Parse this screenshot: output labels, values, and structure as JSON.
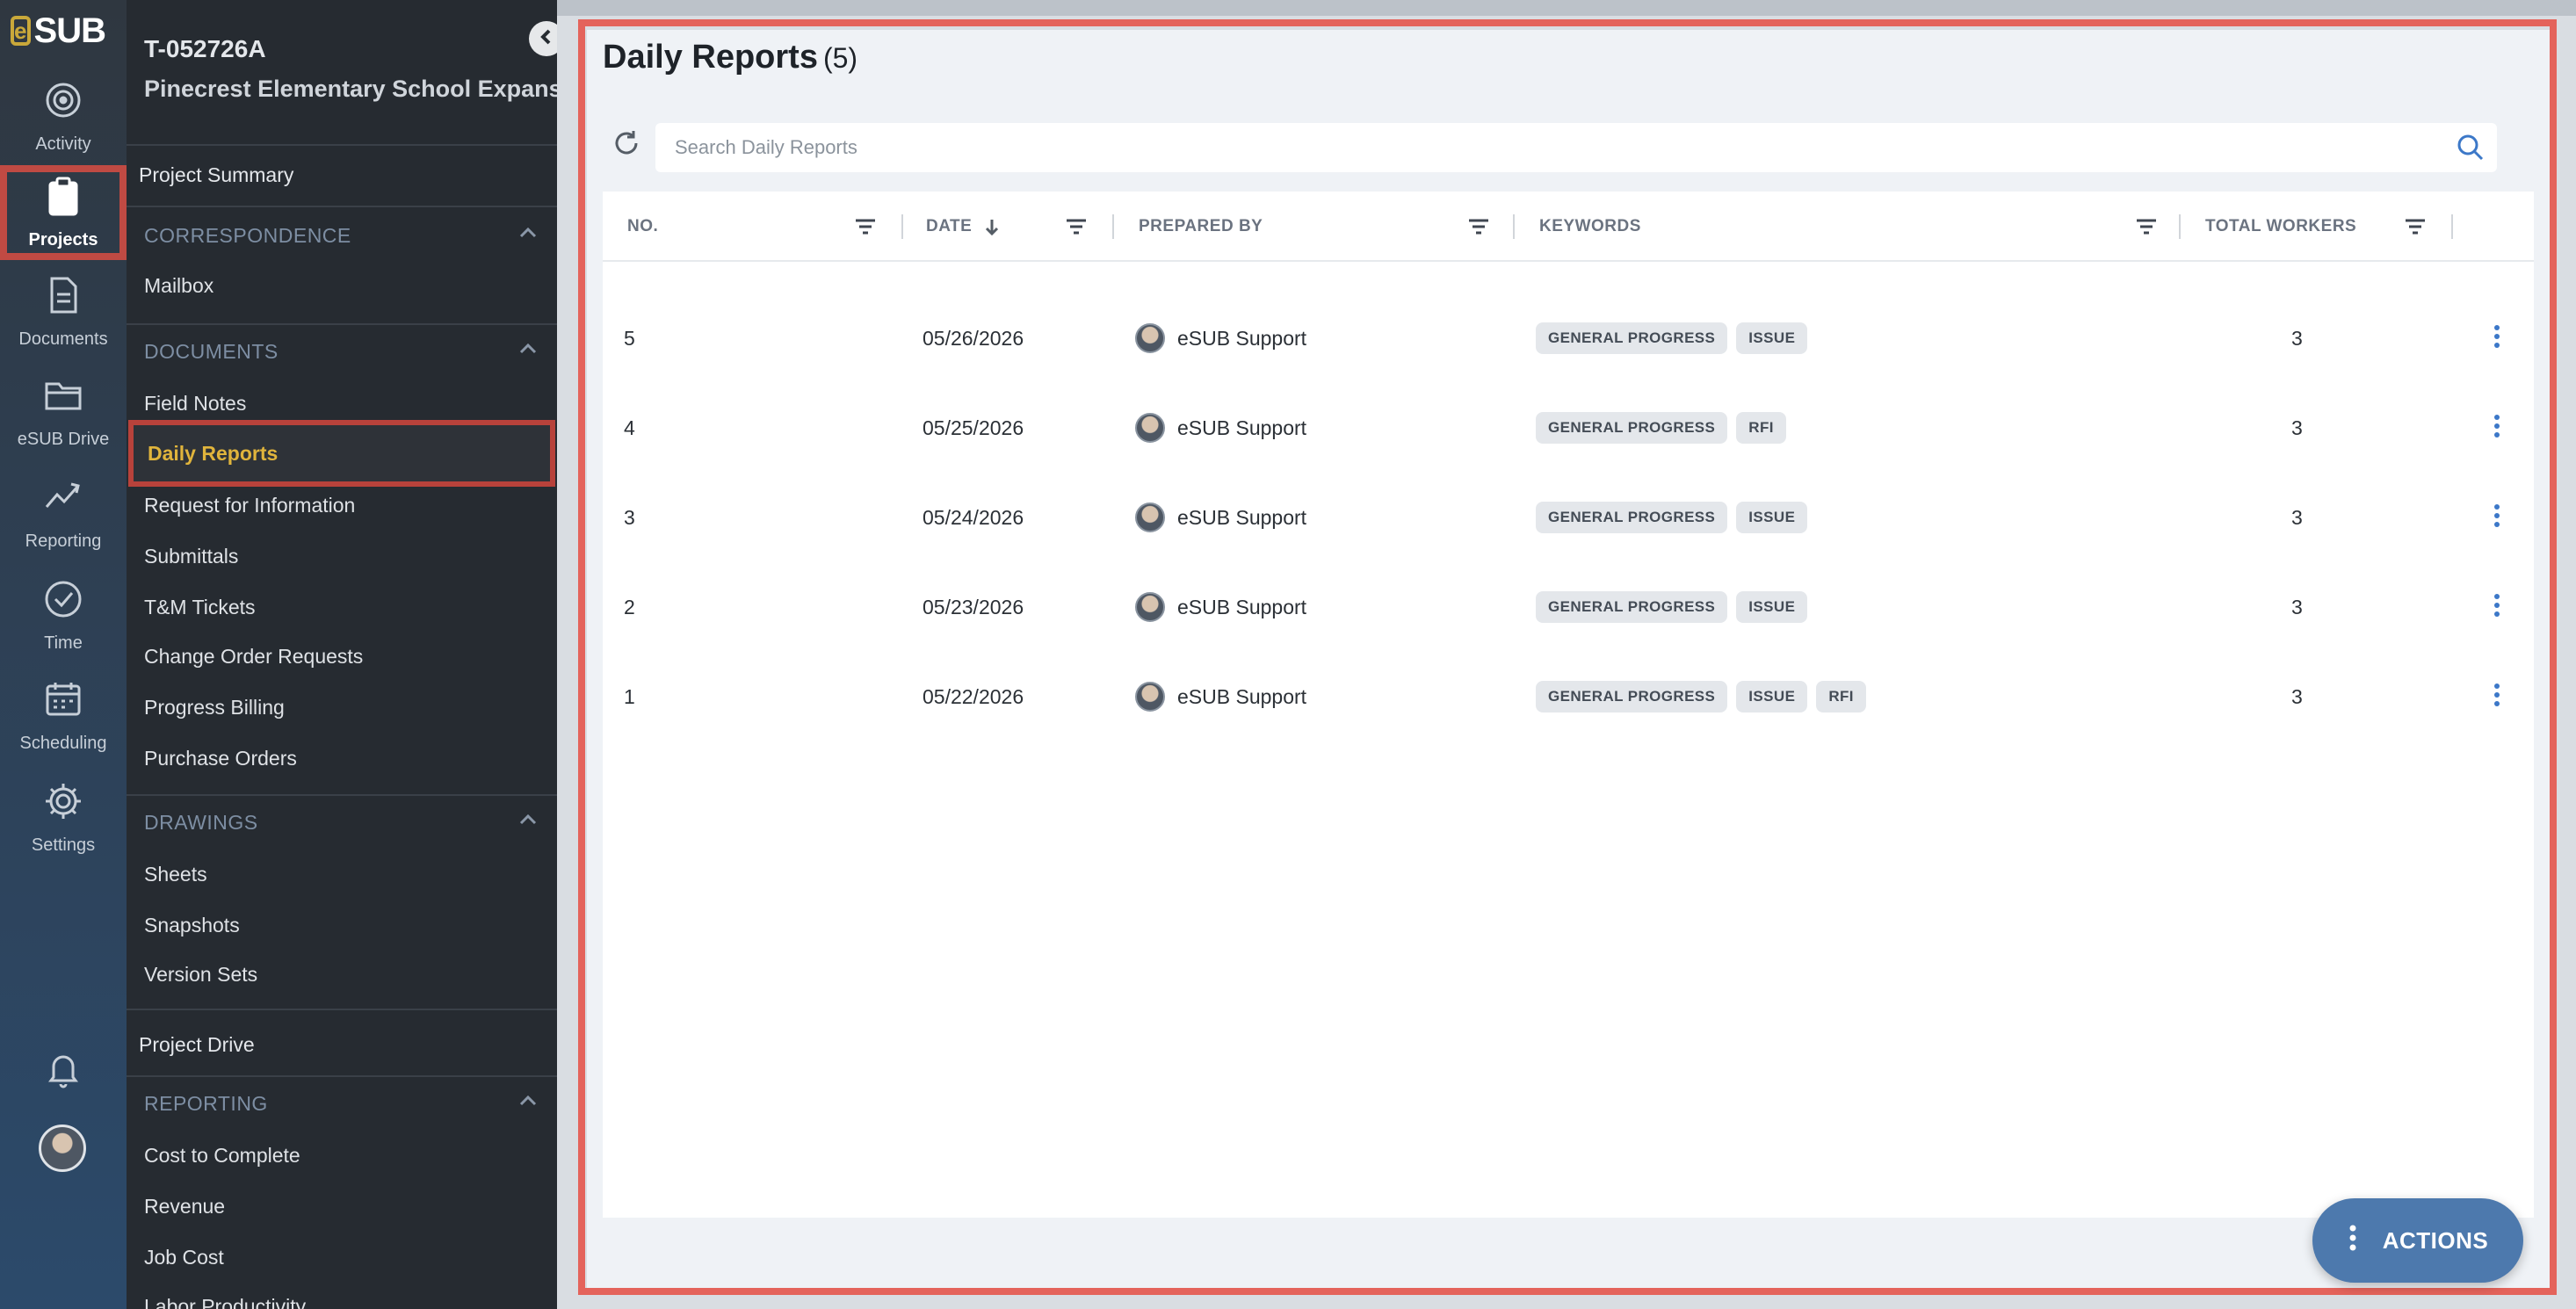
{
  "rail": {
    "logo_text": "SUB",
    "logo_mark": "e",
    "items": [
      {
        "label": "Activity",
        "icon": "activity-icon"
      },
      {
        "label": "Projects",
        "icon": "clipboard-icon"
      },
      {
        "label": "Documents",
        "icon": "document-icon"
      },
      {
        "label": "eSUB Drive",
        "icon": "folder-icon"
      },
      {
        "label": "Reporting",
        "icon": "chart-line-icon"
      },
      {
        "label": "Time",
        "icon": "clock-check-icon"
      },
      {
        "label": "Scheduling",
        "icon": "calendar-icon"
      },
      {
        "label": "Settings",
        "icon": "gear-icon"
      }
    ]
  },
  "project": {
    "code": "T-052726A",
    "name": "Pinecrest Elementary School Expansion"
  },
  "nav": {
    "project_summary": "Project Summary",
    "correspondence": {
      "title": "CORRESPONDENCE",
      "items": [
        "Mailbox"
      ]
    },
    "documents": {
      "title": "DOCUMENTS",
      "items": [
        "Field Notes",
        "Daily Reports",
        "Request for Information",
        "Submittals",
        "T&M Tickets",
        "Change Order Requests",
        "Progress Billing",
        "Purchase Orders"
      ]
    },
    "drawings": {
      "title": "DRAWINGS",
      "items": [
        "Sheets",
        "Snapshots",
        "Version Sets"
      ]
    },
    "project_drive": "Project Drive",
    "reporting": {
      "title": "REPORTING",
      "items": [
        "Cost to Complete",
        "Revenue",
        "Job Cost",
        "Labor Productivity"
      ]
    }
  },
  "page": {
    "title": "Daily Reports",
    "count": "(5)",
    "search_placeholder": "Search Daily Reports"
  },
  "table": {
    "columns": {
      "no": "NO.",
      "date": "DATE",
      "prepared_by": "PREPARED BY",
      "keywords": "KEYWORDS",
      "total_workers": "TOTAL WORKERS"
    },
    "rows": [
      {
        "no": "5",
        "date": "05/26/2026",
        "prepared_by": "eSUB Support",
        "keywords": [
          "GENERAL PROGRESS",
          "ISSUE"
        ],
        "total_workers": "3"
      },
      {
        "no": "4",
        "date": "05/25/2026",
        "prepared_by": "eSUB Support",
        "keywords": [
          "GENERAL PROGRESS",
          "RFI"
        ],
        "total_workers": "3"
      },
      {
        "no": "3",
        "date": "05/24/2026",
        "prepared_by": "eSUB Support",
        "keywords": [
          "GENERAL PROGRESS",
          "ISSUE"
        ],
        "total_workers": "3"
      },
      {
        "no": "2",
        "date": "05/23/2026",
        "prepared_by": "eSUB Support",
        "keywords": [
          "GENERAL PROGRESS",
          "ISSUE"
        ],
        "total_workers": "3"
      },
      {
        "no": "1",
        "date": "05/22/2026",
        "prepared_by": "eSUB Support",
        "keywords": [
          "GENERAL PROGRESS",
          "ISSUE",
          "RFI"
        ],
        "total_workers": "3"
      }
    ]
  },
  "fab": {
    "label": "ACTIONS"
  },
  "colors": {
    "accent": "#3c78c8",
    "highlight_frame": "#e4635b",
    "active_nav": "#e0b43c",
    "fab": "#4d79ad"
  }
}
